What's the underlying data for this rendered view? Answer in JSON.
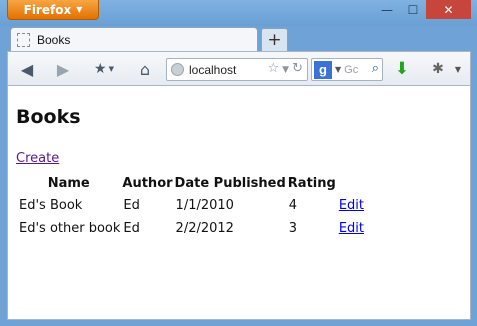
{
  "browser": {
    "app_button": "Firefox",
    "tab_title": "Books",
    "new_tab": "+",
    "url": "localhost",
    "search_engine": "g",
    "search_placeholder": "Gc",
    "close_glyph": "✕",
    "minimize_glyph": "—",
    "maximize_glyph": "☐"
  },
  "page": {
    "heading": "Books",
    "create_link": "Create",
    "columns": [
      "Name",
      "Author",
      "Date Published",
      "Rating"
    ],
    "rows": [
      {
        "name": "Ed's Book",
        "author": "Ed",
        "date": "1/1/2010",
        "rating": "4",
        "action": "Edit"
      },
      {
        "name": "Ed's other book",
        "author": "Ed",
        "date": "2/2/2012",
        "rating": "3",
        "action": "Edit"
      }
    ]
  },
  "colors": {
    "frame": "#6fa3d8",
    "app_button": "#e37100",
    "close_button": "#c7463b",
    "link_visited": "#551a8b",
    "link": "#0000ee"
  }
}
